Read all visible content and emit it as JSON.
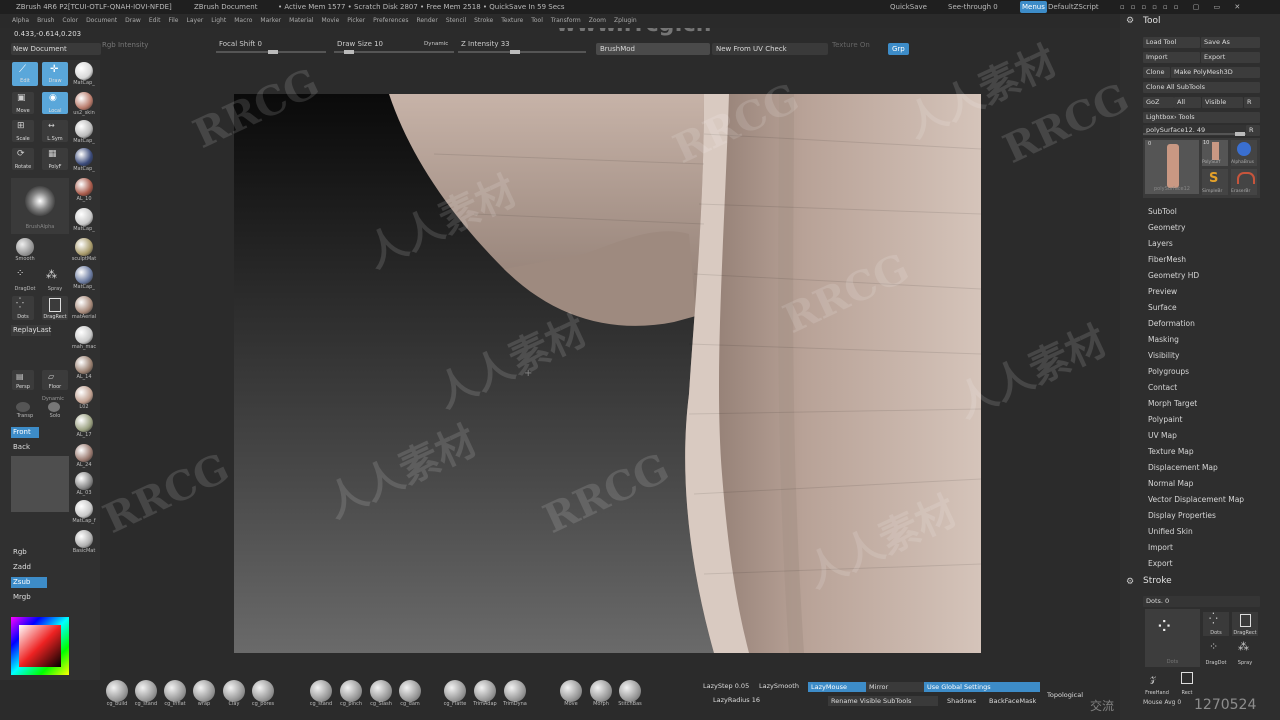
{
  "topbar": {
    "app": "ZBrush 4R6 P2[TCUI-OTLF-QNAH-IOVI-NFDE]",
    "doc": "ZBrush Document",
    "mem": "• Active Mem 1577 • Scratch Disk 2807 • Free Mem 2518 • QuickSave In 59 Secs",
    "quicksave": "QuickSave",
    "seethrough": "See-through 0",
    "menus": "Menus",
    "script": "DefaultZScript",
    "website": "www.rrcg.cn"
  },
  "menubar": [
    "Alpha",
    "Brush",
    "Color",
    "Document",
    "Draw",
    "Edit",
    "File",
    "Layer",
    "Light",
    "Macro",
    "Marker",
    "Material",
    "Movie",
    "Picker",
    "Preferences",
    "Render",
    "Stencil",
    "Stroke",
    "Texture",
    "Tool",
    "Transform",
    "Zoom",
    "Zplugin"
  ],
  "coords": "0.433,-0.614,0.203",
  "controls": {
    "new_document": "New Document",
    "rgb_intensity": "Rgb Intensity",
    "focal_shift": "Focal Shift 0",
    "draw_size": "Draw Size 10",
    "dynamic": "Dynamic",
    "z_intensity": "Z Intensity 33",
    "brushmod": "BrushMod",
    "new_from_uv": "New From UV Check",
    "texture_on": "Texture On",
    "grp": "Grp"
  },
  "left": {
    "edit": "Edit",
    "draw": "Draw",
    "move": "Move",
    "local": "Local",
    "scale": "Scale",
    "lsym": "L.Sym",
    "rotate": "Rotate",
    "polyf": "PolyF",
    "brushalpha": "BrushAlpha",
    "smooth": "Smooth",
    "dragdot": "DragDot",
    "spray": "Spray",
    "dots": "Dots",
    "dragrect": "DragRect",
    "replaylast": "ReplayLast",
    "persp": "Persp",
    "floor": "Floor",
    "dynamic": "Dynamic",
    "solo": "Solo",
    "transp": "Transp",
    "front": "Front",
    "back": "Back",
    "rgb": "Rgb",
    "zadd": "Zadd",
    "zsub": "Zsub",
    "mrgb": "Mrgb",
    "materials": [
      "MatCap_",
      "us2_skin",
      "MatCap_",
      "MatCap_",
      "AL_10",
      "MatCap_",
      "sculptMat",
      "MatCap_",
      "matAerial",
      "mah_mac",
      "AL_14",
      "L02",
      "AL_17",
      "AL_24",
      "AL_03",
      "MatCap_f",
      "BasicMat"
    ]
  },
  "right": {
    "tool_title": "Tool",
    "load_tool": "Load Tool",
    "save_as": "Save As",
    "import": "Import",
    "export": "Export",
    "clone": "Clone",
    "make_polymesh": "Make PolyMesh3D",
    "clone_all": "Clone All SubTools",
    "goz": "GoZ",
    "all": "All",
    "visible": "Visible",
    "r": "R",
    "lightbox_tools": "Lightbox› Tools",
    "poly_surface": "polySurface12. 49",
    "thumbs": [
      "polySurface12",
      "PolySurf",
      "AlphaBrus",
      "SimpleBr",
      "EraserBr"
    ],
    "thumb_counts": [
      "0",
      "10",
      "",
      ""
    ],
    "menu": [
      "SubTool",
      "Geometry",
      "Layers",
      "FiberMesh",
      "Geometry HD",
      "Preview",
      "Surface",
      "Deformation",
      "Masking",
      "Visibility",
      "Polygroups",
      "Contact",
      "Morph Target",
      "Polypaint",
      "UV Map",
      "Texture Map",
      "Displacement Map",
      "Normal Map",
      "Vector Displacement Map",
      "Display Properties",
      "Unified Skin",
      "Import",
      "Export"
    ],
    "stroke_title": "Stroke",
    "dots": "Dots. 0",
    "stroke_icons": [
      "Dots",
      "Dots",
      "DragRect",
      "DragDot",
      "Spray",
      "FreeHand",
      "Rect"
    ],
    "mouse_avg": "Mouse Avg 0"
  },
  "bottom": {
    "brushes": [
      "cg_build",
      "cg_stand",
      "cg_Inflat",
      "wrap",
      "Clay",
      "cg_pores",
      "cg_stand",
      "cg_pinch",
      "cg_Slash",
      "cg_dam",
      "cg_Flatte",
      "TrimAdap",
      "TrimDyna",
      "Move",
      "Morph",
      "StitchBas"
    ],
    "lazystep": "LazyStep 0.05",
    "lazysmooth": "LazySmooth",
    "lazymouse": "LazyMouse",
    "lazyradius": "LazyRadius 16",
    "mirror": "Mirror",
    "use_global": "Use Global Settings",
    "rename_visible": "Rename Visible SubTools",
    "shadows": "Shadows",
    "backfacemask": "BackFaceMask",
    "topological": "Topological"
  },
  "watermarks": [
    "RRCG",
    "人人素材",
    "RRCG",
    "人人素材",
    "RRCG",
    "人人素材",
    "RRCG",
    "人人素材",
    "RRCG",
    "人人素材",
    "RRCG",
    "人人素材"
  ],
  "footer_id": "1270524",
  "footer_cn": "交流"
}
